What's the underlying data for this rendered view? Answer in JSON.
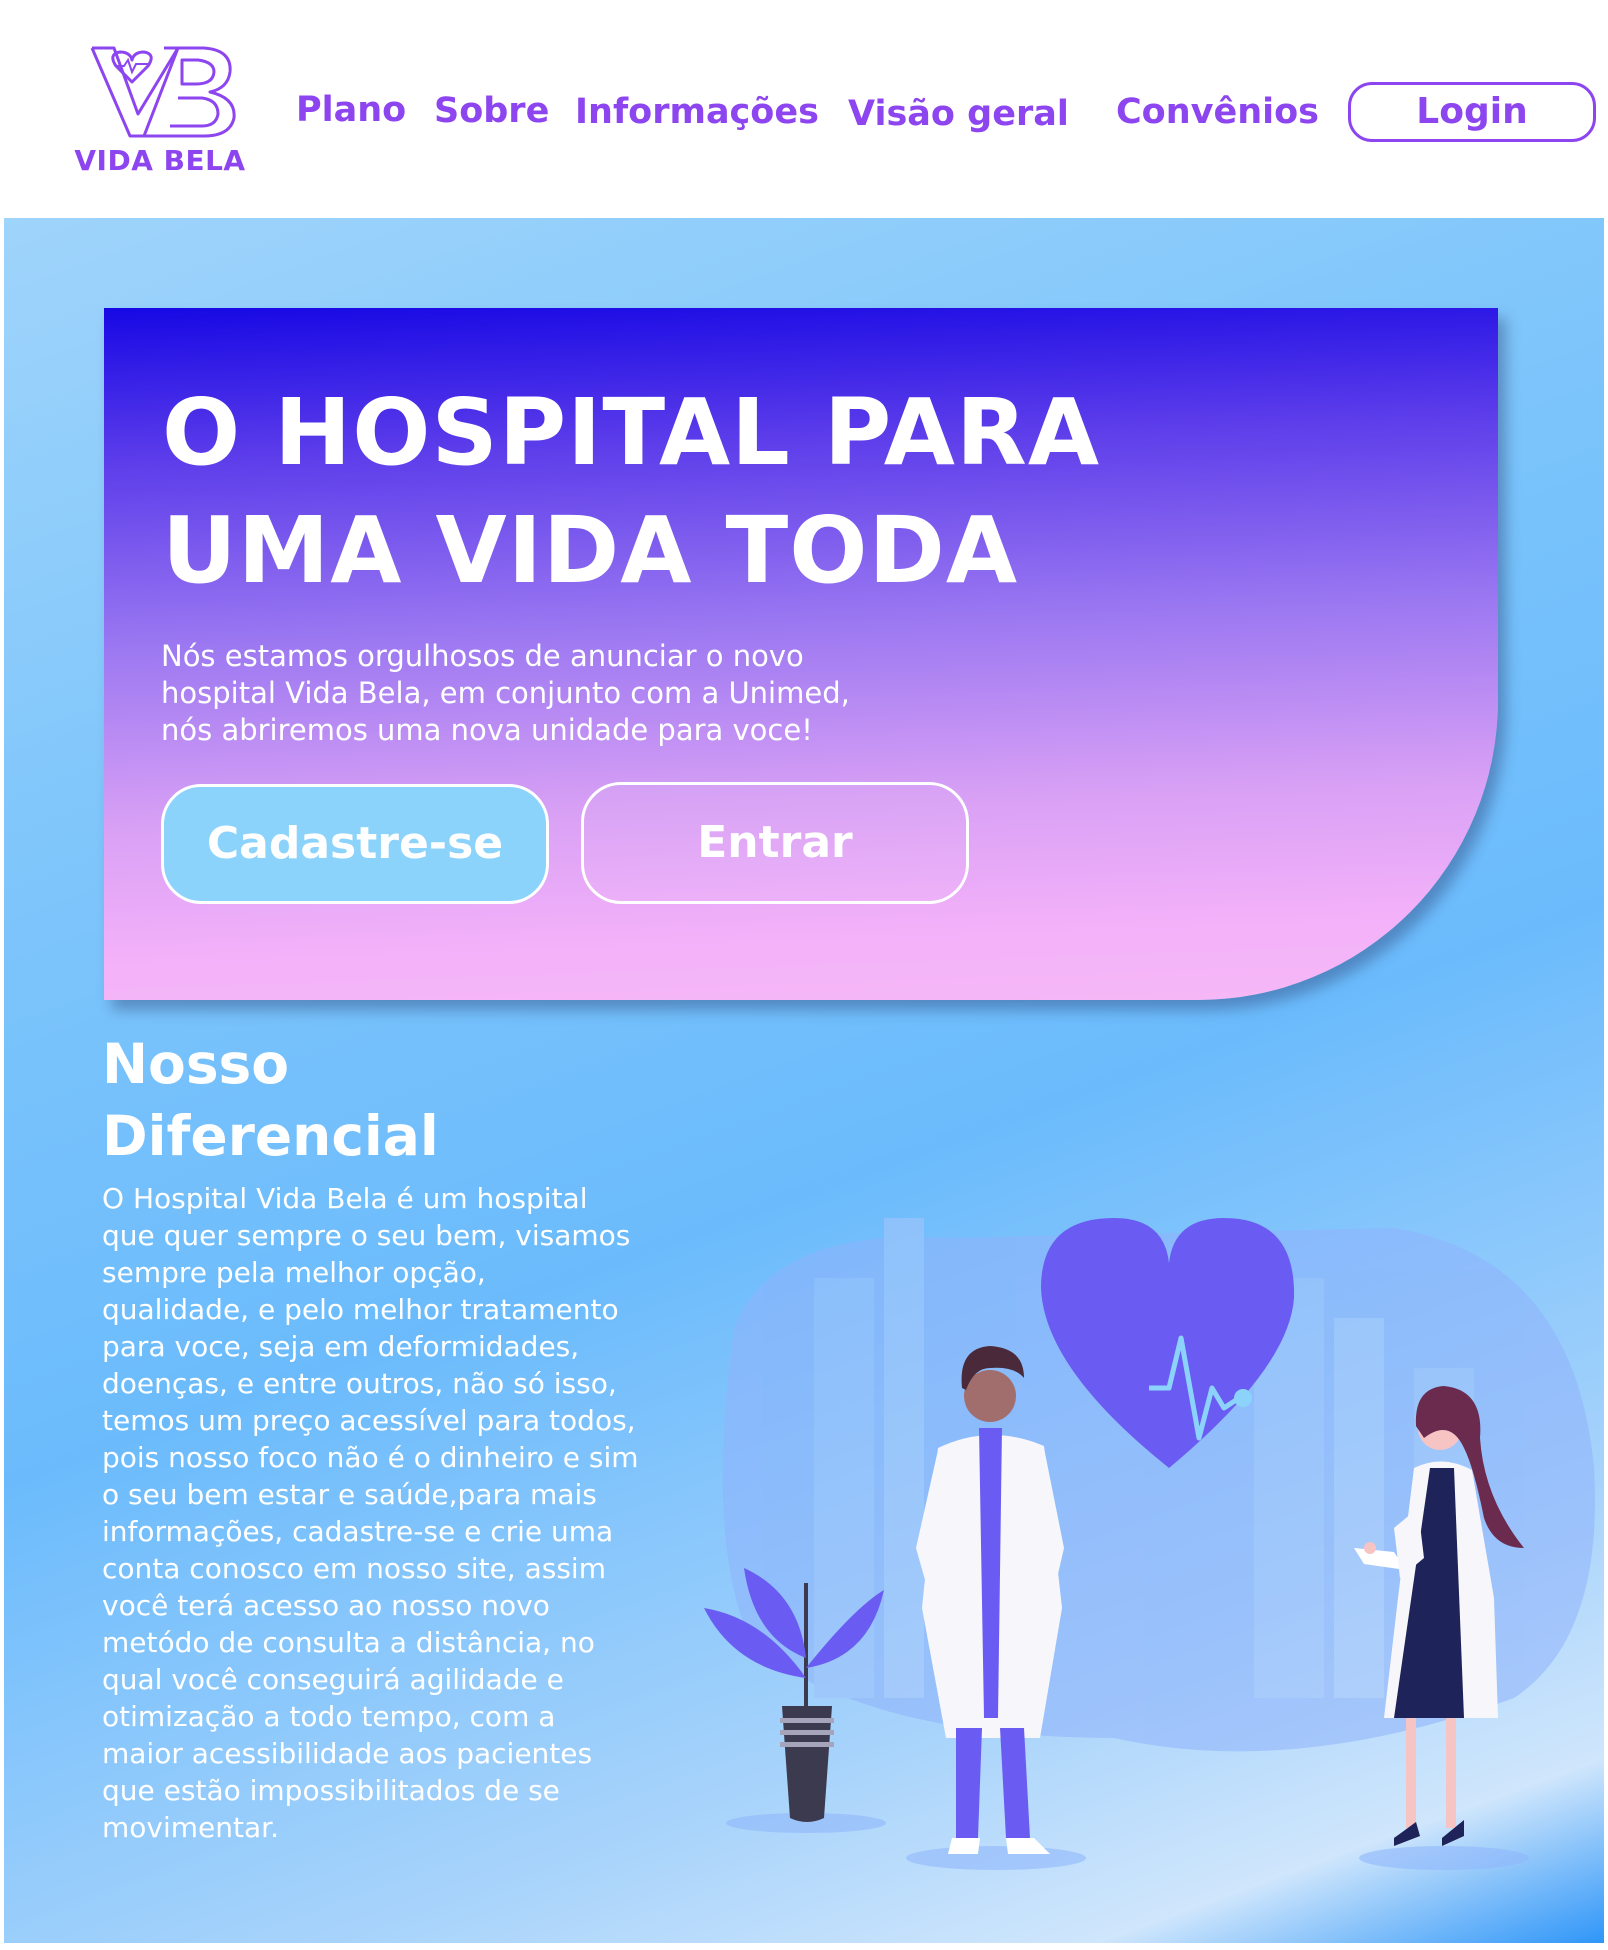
{
  "brand": {
    "name": "VIDA BELA",
    "color": "#8d45f0"
  },
  "nav": {
    "items": [
      {
        "label": "Plano"
      },
      {
        "label": "Sobre"
      },
      {
        "label": "Informações"
      },
      {
        "label": "Visão geral"
      },
      {
        "label": "Convênios"
      }
    ],
    "login_label": "Login"
  },
  "hero": {
    "title_lines": [
      "O HOSPITAL PARA",
      "UMA VIDA TODA"
    ],
    "text_lines": [
      "Nós estamos orgulhosos de anunciar o novo",
      "hospital Vida Bela, em conjunto com a Unimed,",
      "nós abriremos uma nova unidade para voce!"
    ],
    "signup_label": "Cadastre-se",
    "enter_label": "Entrar"
  },
  "diferencial": {
    "title_lines": [
      "Nosso",
      "Diferencial"
    ],
    "text_lines": [
      "O Hospital Vida Bela é um hospital",
      "que quer sempre o seu bem, visamos",
      "sempre pela melhor opção,",
      "qualidade, e pelo melhor tratamento",
      "para voce, seja em deformidades,",
      "doenças, e entre outros, não só isso,",
      "temos um preço acessível para todos,",
      "pois nosso foco não é o dinheiro e sim",
      "o seu bem estar e saúde,para mais",
      "informações, cadastre-se e crie uma",
      "conta conosco em nosso site, assim",
      "você terá acesso ao nosso novo",
      "metódo de consulta a distância, no",
      "qual você conseguirá agilidade e",
      "otimização a todo  tempo, com a",
      "maior acessibilidade aos pacientes",
      "que estão impossibilitados de se",
      "movimentar."
    ]
  },
  "colors": {
    "accent": "#8d45f0",
    "hero_top": "#1708e4",
    "hero_bottom": "#f6b8f6",
    "signup_bg": "#8cd3fb",
    "heart": "#6a5cf2"
  }
}
